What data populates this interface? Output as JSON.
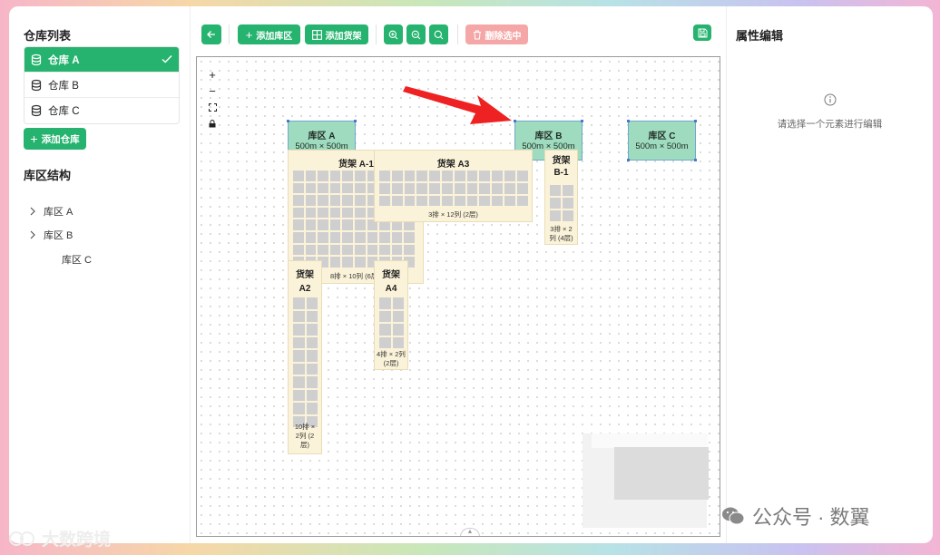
{
  "sidebar": {
    "warehouse_list_title": "仓库列表",
    "warehouses": [
      {
        "label": "仓库 A",
        "active": true
      },
      {
        "label": "仓库 B",
        "active": false
      },
      {
        "label": "仓库 C",
        "active": false
      }
    ],
    "add_warehouse_label": "添加仓库",
    "zone_structure_title": "库区结构",
    "zones": [
      {
        "label": "库区 A",
        "expandable": true
      },
      {
        "label": "库区 B",
        "expandable": true
      },
      {
        "label": "库区 C",
        "expandable": false
      }
    ]
  },
  "toolbar": {
    "add_zone_label": "添加库区",
    "add_rack_label": "添加货架",
    "delete_selected_label": "删除选中"
  },
  "canvas": {
    "zones": [
      {
        "name": "库区 A",
        "size": "500m × 500m"
      },
      {
        "name": "库区 B",
        "size": "500m × 500m"
      },
      {
        "name": "库区 C",
        "size": "500m × 500m"
      }
    ],
    "racks": {
      "a1": {
        "name": "货架 A-1",
        "detail": "8排 × 10列 (6层)"
      },
      "a3": {
        "name": "货架 A3",
        "detail": "3排 × 12列 (2层)"
      },
      "b1": {
        "name": "货架 B-1",
        "detail": "3排 × 2列 (4层)"
      },
      "a2": {
        "name": "货架 A2",
        "detail": "10排 × 2列 (2层)"
      },
      "a4": {
        "name": "货架 A4",
        "detail": "4排 × 2列 (2层)"
      }
    }
  },
  "properties": {
    "title": "属性编辑",
    "hint": "请选择一个元素进行编辑"
  },
  "watermarks": {
    "right": "公众号 · 数翼",
    "left": "大数跨境"
  },
  "colors": {
    "accent": "#26b36f",
    "danger": "#f5a7a7",
    "zone_fill": "#9fdcbf",
    "rack_fill": "#fbf3d9",
    "arrow": "#ee2222"
  }
}
